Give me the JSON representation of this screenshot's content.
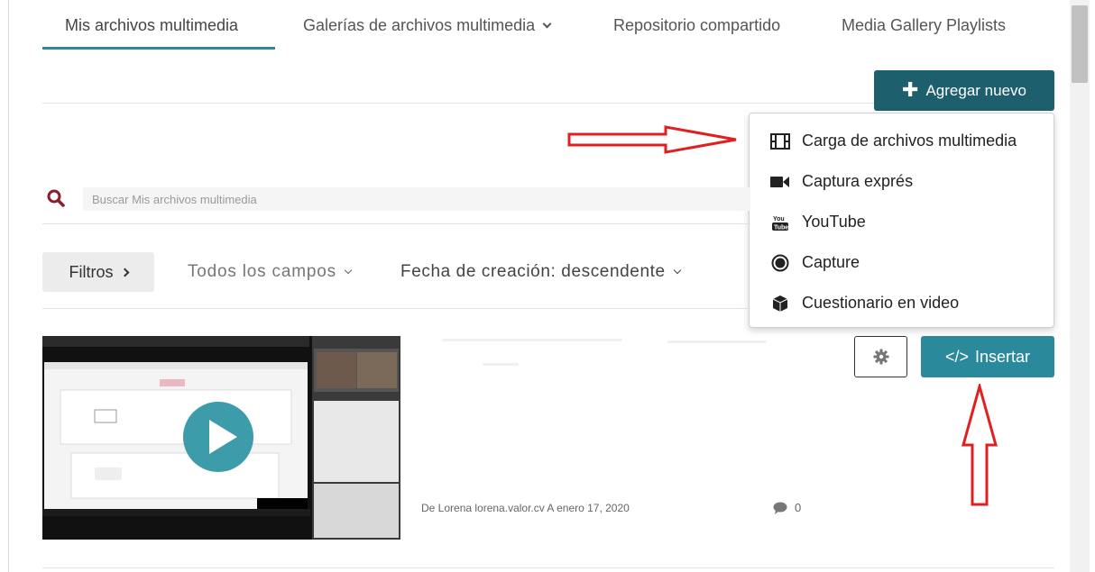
{
  "tabs": [
    {
      "label": "Mis archivos multimedia",
      "active": true
    },
    {
      "label": "Galerías de archivos multimedia",
      "has_dropdown": true
    },
    {
      "label": "Repositorio compartido"
    },
    {
      "label": "Media Gallery Playlists"
    }
  ],
  "add_button": {
    "label": "Agregar nuevo",
    "icon": "plus-icon"
  },
  "add_menu": [
    {
      "label": "Carga de archivos multimedia",
      "icon": "film-icon"
    },
    {
      "label": "Captura exprés",
      "icon": "video-camera-icon"
    },
    {
      "label": "YouTube",
      "icon": "youtube-icon"
    },
    {
      "label": "Capture",
      "icon": "record-icon"
    },
    {
      "label": "Cuestionario en video",
      "icon": "cube-icon"
    }
  ],
  "search": {
    "placeholder": "Buscar Mis archivos multimedia"
  },
  "filters": {
    "button_label": "Filtros",
    "fields_label": "Todos los campos",
    "sort_label": "Fecha de creación: descendente"
  },
  "entry": {
    "meta": "De Lorena lorena.valor.cv A enero 17, 2020",
    "comments": "0",
    "insert_label": "Insertar",
    "insert_icon": "</>"
  },
  "colors": {
    "accent": "#2a8a9b",
    "dark_teal": "#1d5f6c",
    "annotation_red": "#e02020"
  }
}
